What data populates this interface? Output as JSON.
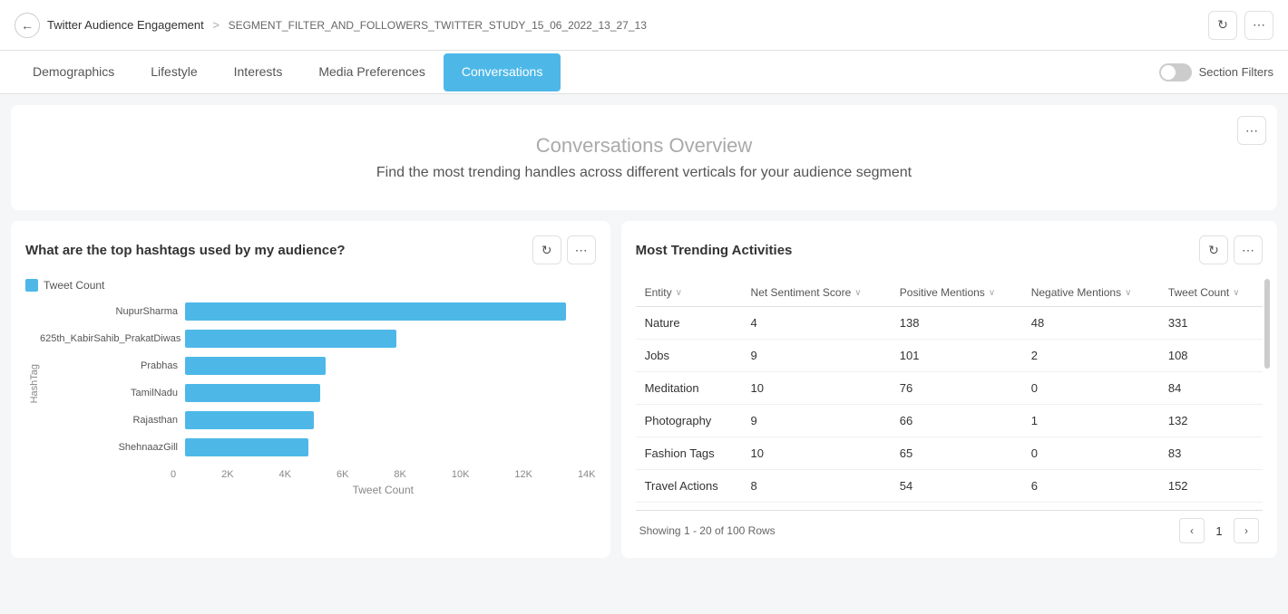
{
  "header": {
    "back_label": "←",
    "title": "Twitter Audience Engagement",
    "separator": ">",
    "segment": "SEGMENT_FILTER_AND_FOLLOWERS_TWITTER_STUDY_15_06_2022_13_27_13",
    "refresh_icon": "↻",
    "more_icon": "⋯"
  },
  "nav": {
    "tabs": [
      {
        "label": "Demographics",
        "active": false
      },
      {
        "label": "Lifestyle",
        "active": false
      },
      {
        "label": "Interests",
        "active": false
      },
      {
        "label": "Media Preferences",
        "active": false
      },
      {
        "label": "Conversations",
        "active": true
      }
    ],
    "section_filters_label": "Section Filters",
    "toggle_on": false
  },
  "hero": {
    "title": "Conversations Overview",
    "subtitle": "Find the most trending handles across different verticals for your audience segment",
    "more_icon": "⋯"
  },
  "chart_panel": {
    "title": "What are the top hashtags used by my audience?",
    "legend_label": "Tweet Count",
    "y_axis_label": "HashTag",
    "x_axis_label": "Tweet Count",
    "x_ticks": [
      "0",
      "2K",
      "4K",
      "6K",
      "8K",
      "10K",
      "12K",
      "14K"
    ],
    "max_value": 14000,
    "bars": [
      {
        "label": "NupurSharma",
        "value": 13000
      },
      {
        "label": "625th_KabirSahib_PrakatDiwas",
        "value": 7200
      },
      {
        "label": "Prabhas",
        "value": 4800
      },
      {
        "label": "TamilNadu",
        "value": 4600
      },
      {
        "label": "Rajasthan",
        "value": 4400
      },
      {
        "label": "ShehnaazGill",
        "value": 4200
      }
    ],
    "refresh_icon": "↻",
    "more_icon": "⋯"
  },
  "table_panel": {
    "title": "Most Trending Activities",
    "refresh_icon": "↻",
    "more_icon": "⋯",
    "columns": [
      {
        "key": "entity",
        "label": "Entity"
      },
      {
        "key": "net_sentiment",
        "label": "Net Sentiment Score"
      },
      {
        "key": "positive_mentions",
        "label": "Positive Mentions"
      },
      {
        "key": "negative_mentions",
        "label": "Negative Mentions"
      },
      {
        "key": "tweet_count",
        "label": "Tweet Count"
      }
    ],
    "rows": [
      {
        "entity": "Nature",
        "net_sentiment": 4,
        "positive_mentions": 138,
        "negative_mentions": 48,
        "tweet_count": 331
      },
      {
        "entity": "Jobs",
        "net_sentiment": 9,
        "positive_mentions": 101,
        "negative_mentions": 2,
        "tweet_count": 108
      },
      {
        "entity": "Meditation",
        "net_sentiment": 10,
        "positive_mentions": 76,
        "negative_mentions": 0,
        "tweet_count": 84
      },
      {
        "entity": "Photography",
        "net_sentiment": 9,
        "positive_mentions": 66,
        "negative_mentions": 1,
        "tweet_count": 132
      },
      {
        "entity": "Fashion Tags",
        "net_sentiment": 10,
        "positive_mentions": 65,
        "negative_mentions": 0,
        "tweet_count": 83
      },
      {
        "entity": "Travel Actions",
        "net_sentiment": 8,
        "positive_mentions": 54,
        "negative_mentions": 6,
        "tweet_count": 152
      }
    ],
    "pagination": {
      "info": "Showing 1 - 20 of 100 Rows",
      "current_page": 1,
      "prev_icon": "‹",
      "next_icon": "›"
    }
  }
}
